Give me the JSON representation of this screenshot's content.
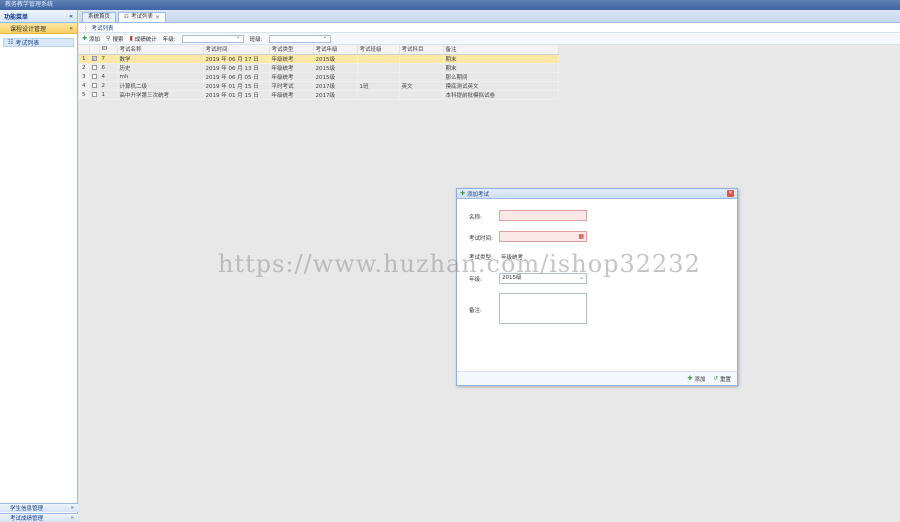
{
  "titlebar": {
    "text": "教务教学管理系统"
  },
  "sidebar": {
    "header": "功能菜单",
    "header_icon": "«",
    "section": "课程设计管理",
    "section_icon": "«",
    "item": "考试列表",
    "bottom1": "学生信息管理",
    "bottom2": "考试成绩管理",
    "bottom_icon": "»"
  },
  "tabs": [
    {
      "label": "系统首页"
    },
    {
      "label": "考试列表"
    }
  ],
  "panel": {
    "title": "考试列表"
  },
  "toolbar": {
    "add": "添加",
    "search": "搜索",
    "stats": "成绩统计",
    "grade_label": "年级:",
    "class_label": "班级:"
  },
  "grid": {
    "columns": [
      "",
      "",
      "ID",
      "考试名称",
      "考试时间",
      "考试类型",
      "考试年级",
      "考试班级",
      "考试科目",
      "备注"
    ],
    "rows": [
      [
        "1",
        "✓",
        "7",
        "数学",
        "2019 年 06 月 17 日",
        "年级统考",
        "2015级",
        "",
        "",
        "期末"
      ],
      [
        "2",
        "",
        "6",
        "历史",
        "2019 年 06 月 13 日",
        "年级统考",
        "2015级",
        "",
        "",
        "期末"
      ],
      [
        "3",
        "",
        "4",
        "mh",
        "2019 年 06 月 05 日",
        "年级统考",
        "2015级",
        "",
        "",
        "那么期间"
      ],
      [
        "4",
        "",
        "2",
        "计算机二级",
        "2019 年 01 月 15 日",
        "平时考试",
        "2017级",
        "1班",
        "英文",
        "摸底测试英文"
      ],
      [
        "5",
        "",
        "1",
        "高中升学第三次统考",
        "2019 年 01 月 15 日",
        "年级统考",
        "2017级",
        "",
        "",
        "本科提前批模拟试卷"
      ]
    ]
  },
  "dialog": {
    "title": "添加考试",
    "close": "✕",
    "name_label": "名称:",
    "time_label": "考试时间:",
    "type_label": "考试类型:",
    "type_value": "年级统考",
    "grade_label": "年级:",
    "grade_value": "2015级",
    "remark_label": "备注:",
    "add_button": "添加",
    "reset_button": "重置"
  },
  "watermark": "https://www.huzhan.com/ishop32232"
}
